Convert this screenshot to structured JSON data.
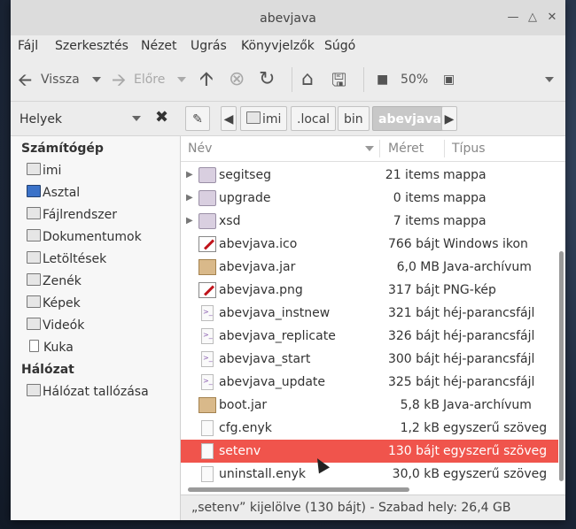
{
  "window": {
    "title": "abevjava"
  },
  "menu": [
    "Fájl",
    "Szerkesztés",
    "Nézet",
    "Ugrás",
    "Könyvjelzők",
    "Súgó"
  ],
  "toolbar": {
    "back": "Vissza",
    "forward": "Előre",
    "zoom": "50%"
  },
  "location": {
    "crumbs": [
      "imi",
      ".local",
      "bin",
      "abevjava"
    ]
  },
  "sidebar": {
    "dropdown": "Helyek",
    "computer_header": "Számítógép",
    "computer_items": [
      "imi",
      "Asztal",
      "Fájlrendszer",
      "Dokumentumok",
      "Letöltések",
      "Zenék",
      "Képek",
      "Videók",
      "Kuka"
    ],
    "network_header": "Hálózat",
    "network_items": [
      "Hálózat tallózása"
    ]
  },
  "columns": {
    "name": "Név",
    "size": "Méret",
    "type": "Típus"
  },
  "files": [
    {
      "name": "segitseg",
      "size": "21 items",
      "type": "mappa",
      "icon": "folder-icon"
    },
    {
      "name": "upgrade",
      "size": "0 items",
      "type": "mappa",
      "icon": "folder-icon"
    },
    {
      "name": "xsd",
      "size": "7 items",
      "type": "mappa",
      "icon": "folder-icon"
    },
    {
      "name": "abevjava.ico",
      "size": "766 bájt",
      "type": "Windows ikon",
      "icon": "image-icon"
    },
    {
      "name": "abevjava.jar",
      "size": "6,0 MB",
      "type": "Java-archívum",
      "icon": "jar-icon"
    },
    {
      "name": "abevjava.png",
      "size": "317 bájt",
      "type": "PNG-kép",
      "icon": "image-icon"
    },
    {
      "name": "abevjava_instnew",
      "size": "321 bájt",
      "type": "héj-parancsfájl",
      "icon": "script-icon"
    },
    {
      "name": "abevjava_replicate",
      "size": "326 bájt",
      "type": "héj-parancsfájl",
      "icon": "script-icon"
    },
    {
      "name": "abevjava_start",
      "size": "300 bájt",
      "type": "héj-parancsfájl",
      "icon": "script-icon"
    },
    {
      "name": "abevjava_update",
      "size": "325 bájt",
      "type": "héj-parancsfájl",
      "icon": "script-icon"
    },
    {
      "name": "boot.jar",
      "size": "5,8 kB",
      "type": "Java-archívum",
      "icon": "jar-icon"
    },
    {
      "name": "cfg.enyk",
      "size": "1,2 kB",
      "type": "egyszerű szöveg",
      "icon": "text-icon"
    },
    {
      "name": "setenv",
      "size": "130 bájt",
      "type": "egyszerű szöveg",
      "icon": "text-icon",
      "selected": true
    },
    {
      "name": "uninstall.enyk",
      "size": "30,0 kB",
      "type": "egyszerű szöveg",
      "icon": "text-icon"
    }
  ],
  "status": "„setenv” kijelölve (130 bájt) - Szabad hely: 26,4 GB"
}
